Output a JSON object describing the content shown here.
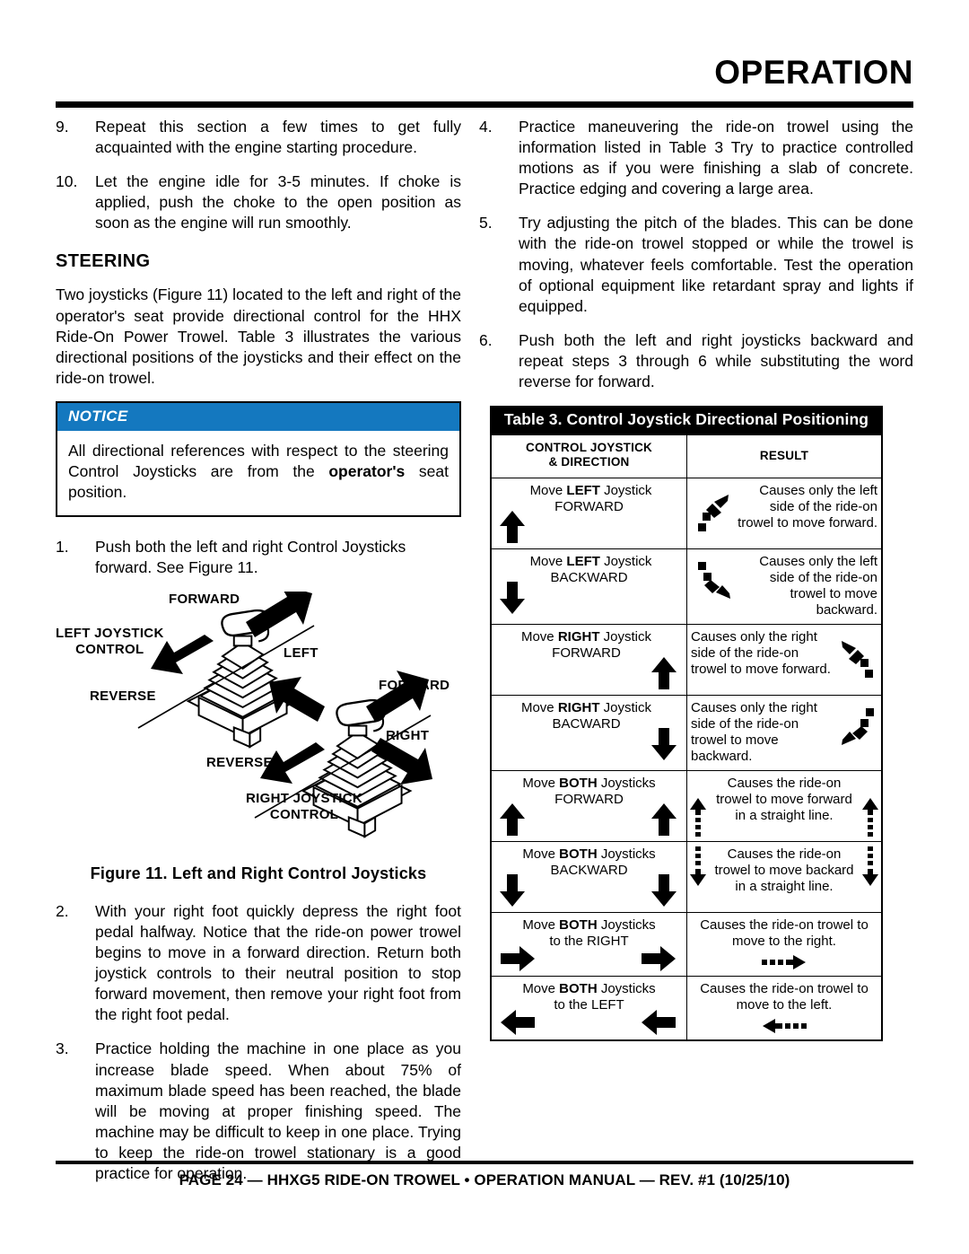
{
  "header": {
    "title": "OPERATION"
  },
  "left_column": {
    "steps": [
      {
        "num": "9.",
        "text": "Repeat this section a few times to get fully acquainted with the engine starting procedure."
      },
      {
        "num": "10.",
        "text": "Let the engine idle for 3-5 minutes. If choke is applied, push the choke to the open position as soon as the engine will run smoothly."
      }
    ],
    "section_heading": "STEERING",
    "steering_paragraph": "Two joysticks (Figure 11) located to the left and right of the operator's seat provide directional control for the HHX Ride-On Power Trowel. Table 3 illustrates the various directional positions of the joysticks and their effect on the ride-on trowel.",
    "notice": {
      "label": "NOTICE",
      "text_part1": "All directional references with respect to the steering Control Joysticks are from the ",
      "text_bold": "operator's",
      "text_part2": " seat position."
    },
    "steps2": [
      {
        "num": "1.",
        "text": "Push both the left and right Control Joysticks forward. See Figure 11."
      }
    ],
    "figure": {
      "caption": "Figure 11. Left and Right Control Joysticks",
      "labels": {
        "forward_left": "FORWARD",
        "left_joystick_control": "LEFT JOYSTICK\nCONTROL",
        "left_joystick_control_line1": "LEFT JOYSTICK",
        "left_joystick_control_line2": "CONTROL",
        "reverse_left": "REVERSE",
        "left": "LEFT",
        "forward_right": "FORWARD",
        "right": "RIGHT",
        "reverse_right": "REVERSE",
        "right_joystick_control_line1": "RIGHT JOYSTICK",
        "right_joystick_control_line2": "CONTROL"
      }
    },
    "steps3": [
      {
        "num": "2.",
        "text": "With your right foot quickly depress the right foot pedal halfway. Notice that the ride-on power trowel begins to move in a forward direction. Return both joystick controls to their neutral position to stop forward movement, then remove your right foot from the right foot pedal."
      },
      {
        "num": "3.",
        "text": "Practice holding the machine in one place as you increase blade speed. When about 75% of maximum blade speed has been reached, the blade will be moving at proper finishing speed. The machine may be difficult to keep in one place. Trying to keep the ride-on trowel stationary is a good practice for operation."
      }
    ]
  },
  "right_column": {
    "steps": [
      {
        "num": "4.",
        "text": "Practice maneuvering the ride-on trowel using the information listed in Table 3 Try to practice controlled motions as if you were finishing a slab of concrete. Practice edging and covering a large area."
      },
      {
        "num": "5.",
        "text": "Try adjusting the pitch of the blades. This can be done with the ride-on trowel stopped or while the trowel is moving, whatever feels comfortable. Test the operation of optional equipment like retardant spray and lights if equipped."
      },
      {
        "num": "6.",
        "text": "Push both the left and right joysticks backward and repeat steps 3 through 6 while substituting the word reverse for forward."
      }
    ]
  },
  "table3": {
    "title": "Table 3. Control Joystick Directional Positioning",
    "columns": [
      {
        "line1": "CONTROL JOYSTICK",
        "line2": "& DIRECTION"
      },
      {
        "line1": "RESULT",
        "line2": ""
      }
    ],
    "rows": [
      {
        "action_pre": "Move ",
        "action_bold": "LEFT",
        "action_post": " Joystick",
        "action_dir": "FORWARD",
        "action_arrow": "arrow-up",
        "action_arrow_pos": "left",
        "result": "Causes only the left side of the ride-on trowel to move forward.",
        "result_arrow": "arrow-diagonal-up-right-dotted",
        "result_arrow_pos": "left",
        "result_text_align": "right"
      },
      {
        "action_pre": "Move ",
        "action_bold": "LEFT",
        "action_post": " Joystick",
        "action_dir": "BACKWARD",
        "action_arrow": "arrow-down",
        "action_arrow_pos": "left",
        "result": "Causes only the left side of the ride-on trowel to move backward.",
        "result_arrow": "arrow-diagonal-down-right-dotted",
        "result_arrow_pos": "left",
        "result_text_align": "right"
      },
      {
        "action_pre": "Move ",
        "action_bold": "RIGHT",
        "action_post": " Joystick",
        "action_dir": "FORWARD",
        "action_arrow": "arrow-up",
        "action_arrow_pos": "right",
        "result": "Causes only the right side of the ride-on trowel to move forward.",
        "result_arrow": "arrow-diagonal-up-left-dotted",
        "result_arrow_pos": "right",
        "result_text_align": "left"
      },
      {
        "action_pre": "Move ",
        "action_bold": "RIGHT",
        "action_post": " Joystick",
        "action_dir": "BACWARD",
        "action_arrow": "arrow-down",
        "action_arrow_pos": "right",
        "result": "Causes only the right side of the ride-on trowel to move backward.",
        "result_arrow": "arrow-diagonal-down-left-dotted",
        "result_arrow_pos": "right",
        "result_text_align": "left"
      },
      {
        "action_pre": "Move ",
        "action_bold": "BOTH",
        "action_post": " Joysticks",
        "action_dir": "FORWARD",
        "action_arrow": "arrow-up",
        "action_arrow_pos": "both",
        "result": "Causes the ride-on trowel to move forward in a straight line.",
        "result_arrow": "arrow-up-dashed-tail",
        "result_arrow_pos": "both",
        "result_text_align": "center"
      },
      {
        "action_pre": "Move ",
        "action_bold": "BOTH",
        "action_post": " Joysticks",
        "action_dir": "BACKWARD",
        "action_arrow": "arrow-down",
        "action_arrow_pos": "both",
        "result": "Causes the ride-on trowel to move backard in a straight line.",
        "result_arrow": "arrow-down-dashed-tail",
        "result_arrow_pos": "both",
        "result_text_align": "center"
      },
      {
        "action_pre": "Move ",
        "action_bold": "BOTH",
        "action_post": " Joysticks",
        "action_dir": "to the RIGHT",
        "action_arrow": "arrow-right",
        "action_arrow_pos": "both",
        "result": "Causes the ride-on trowel to move to the right.",
        "result_arrow": "arrow-right-dotted-tail",
        "result_arrow_pos": "center",
        "result_text_align": "center"
      },
      {
        "action_pre": "Move ",
        "action_bold": "BOTH",
        "action_post": " Joysticks",
        "action_dir": "to the LEFT",
        "action_arrow": "arrow-left",
        "action_arrow_pos": "both",
        "result": "Causes the ride-on trowel to move to the left.",
        "result_arrow": "arrow-left-dotted-tail",
        "result_arrow_pos": "center",
        "result_text_align": "center"
      }
    ]
  },
  "footer": {
    "text": "PAGE 24 — HHXG5 RIDE-ON TROWEL • OPERATION MANUAL — REV. #1 (10/25/10)"
  },
  "colors": {
    "notice_header": "#1478bf",
    "table_title_bg": "#000000",
    "rule": "#000000"
  }
}
